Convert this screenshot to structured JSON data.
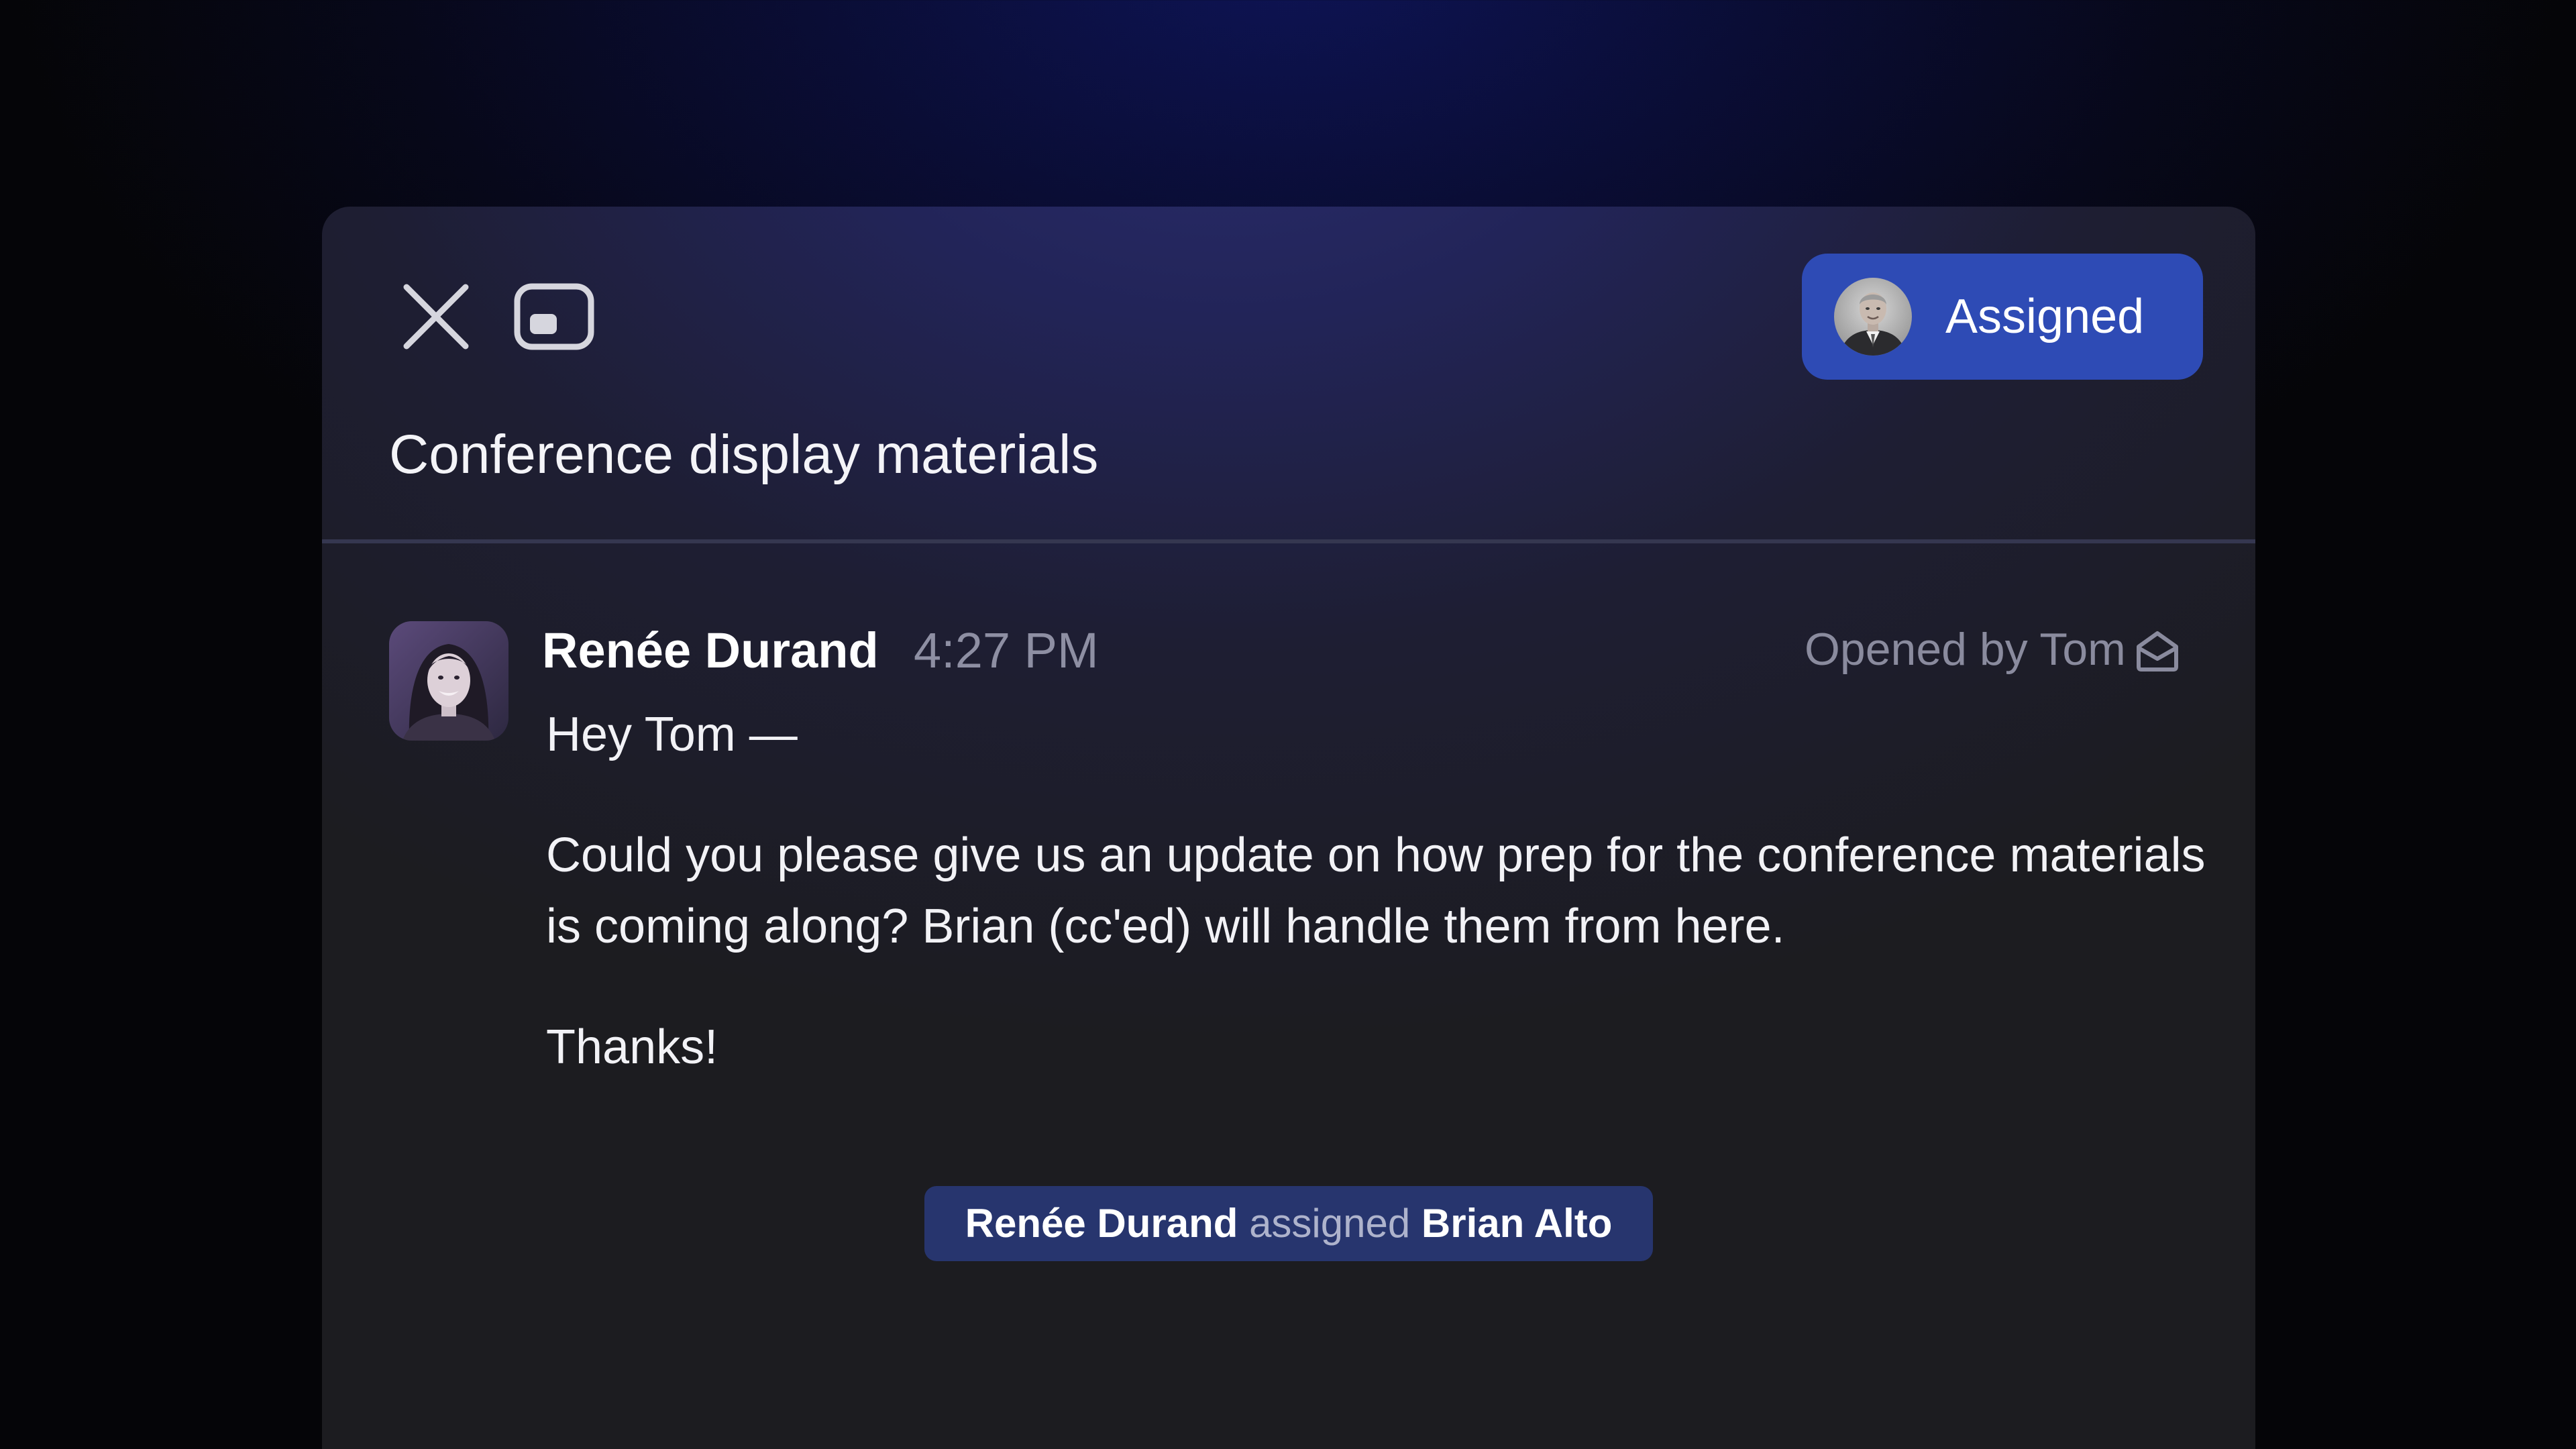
{
  "header": {
    "assigned_label": "Assigned",
    "title": "Conference display materials"
  },
  "message": {
    "sender": "Renée Durand",
    "time": "4:27 PM",
    "opened_status": "Opened by Tom",
    "greeting": "Hey Tom —",
    "body_line1": "Could you please give us an update on how prep for the conference materials",
    "body_line2": "is coming along? Brian (cc'ed) will handle them from here.",
    "closing": "Thanks!"
  },
  "activity": {
    "actor": "Renée Durand",
    "action": "assigned",
    "target": "Brian Alto"
  },
  "icons": {
    "close": "close-icon",
    "window": "minimize-window-icon",
    "envelope": "envelope-open-icon"
  },
  "colors": {
    "accent": "#2e4bb5",
    "activity_bg": "#27356e",
    "muted_text": "#8e8fa3"
  }
}
